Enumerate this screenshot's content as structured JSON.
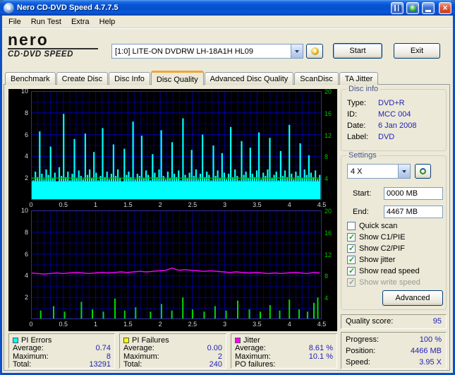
{
  "window": {
    "title": "Nero CD-DVD Speed 4.7.7.5"
  },
  "icons": {
    "close": "×"
  },
  "menu": {
    "items": [
      "File",
      "Run Test",
      "Extra",
      "Help"
    ]
  },
  "header": {
    "logo": {
      "line1": "nero",
      "line2": "CD·DVD SPEED"
    },
    "drive_select": {
      "value": "[1:0]  LITE-ON DVDRW LH-18A1H HL09"
    },
    "start_button": "Start",
    "exit_button": "Exit"
  },
  "tabs": [
    {
      "label": "Benchmark",
      "active": false
    },
    {
      "label": "Create Disc",
      "active": false
    },
    {
      "label": "Disc Info",
      "active": false
    },
    {
      "label": "Disc Quality",
      "active": true
    },
    {
      "label": "Advanced Disc Quality",
      "active": false
    },
    {
      "label": "ScanDisc",
      "active": false
    },
    {
      "label": "TA Jitter",
      "active": false
    }
  ],
  "disc_info": {
    "title": "Disc info",
    "rows": [
      {
        "label": "Type:",
        "value": "DVD+R"
      },
      {
        "label": "ID:",
        "value": "MCC 004"
      },
      {
        "label": "Date:",
        "value": "6 Jan 2008"
      },
      {
        "label": "Label:",
        "value": "DVD"
      }
    ]
  },
  "settings": {
    "title": "Settings",
    "speed_value": "4 X",
    "start_label": "Start:",
    "start_value": "0000 MB",
    "end_label": "End:",
    "end_value": "4467 MB",
    "checkboxes": [
      {
        "label": "Quick scan",
        "checked": false,
        "disabled": false
      },
      {
        "label": "Show C1/PIE",
        "checked": true,
        "disabled": false
      },
      {
        "label": "Show C2/PIF",
        "checked": true,
        "disabled": false
      },
      {
        "label": "Show jitter",
        "checked": true,
        "disabled": false
      },
      {
        "label": "Show read speed",
        "checked": true,
        "disabled": false
      },
      {
        "label": "Show write speed",
        "checked": true,
        "disabled": true
      }
    ],
    "advanced_button": "Advanced"
  },
  "quality": {
    "label": "Quality score:",
    "value": "95"
  },
  "progress": {
    "rows": [
      {
        "label": "Progress:",
        "value": "100 %"
      },
      {
        "label": "Position:",
        "value": "4466 MB"
      },
      {
        "label": "Speed:",
        "value": "3.95 X"
      }
    ]
  },
  "stats_panels": [
    {
      "name": "PI Errors",
      "color": "#00ffff",
      "rows": [
        {
          "label": "Average:",
          "value": "0.74"
        },
        {
          "label": "Maximum:",
          "value": "8"
        },
        {
          "label": "Total:",
          "value": "13291"
        }
      ]
    },
    {
      "name": "PI Failures",
      "color": "#ffff00",
      "rows": [
        {
          "label": "Average:",
          "value": "0.00"
        },
        {
          "label": "Maximum:",
          "value": "2"
        },
        {
          "label": "Total:",
          "value": "240"
        }
      ]
    },
    {
      "name": "Jitter",
      "color": "#ff00ff",
      "rows": [
        {
          "label": "Average:",
          "value": "8.61 %"
        },
        {
          "label": "Maximum:",
          "value": "10.1 %"
        },
        {
          "label": "PO failures:",
          "value": ""
        }
      ]
    }
  ],
  "chart_data": [
    {
      "id": "quality-top",
      "type": "area",
      "title": "PI Errors and read speed vs disc position (GB)",
      "x_range": [
        0,
        4.5
      ],
      "x_end": 4.47,
      "x_ticks": [
        "0",
        "0.5",
        "1",
        "1.5",
        "2",
        "2.5",
        "3",
        "3.5",
        "4",
        "4.5"
      ],
      "left_axis": {
        "max": 10,
        "ticks": [
          2,
          4,
          6,
          8,
          10
        ],
        "color": "#d8d8d8"
      },
      "right_axis": {
        "max": 20,
        "ticks": [
          4,
          8,
          12,
          16,
          20
        ],
        "color": "#00c800"
      },
      "grid": {
        "x_minor": 0.1,
        "x_major": 0.5,
        "y_minor": 1,
        "y_major": 2
      },
      "series": [
        {
          "name": "PI Errors",
          "type": "spikes",
          "axis": "left",
          "color": "#00ffff",
          "base": 1.7,
          "values": [
            2.2,
            1.8,
            2.6,
            2.1,
            6.3,
            2.4,
            1.9,
            2.8,
            2.3,
            4.9,
            2.0,
            2.5,
            1.7,
            3.0,
            2.2,
            7.9,
            2.1,
            2.6,
            1.8,
            2.4,
            5.6,
            2.0,
            2.7,
            2.2,
            1.9,
            6.1,
            2.3,
            2.8,
            2.0,
            4.4,
            2.5,
            1.8,
            2.2,
            6.6,
            2.1,
            2.6,
            1.9,
            2.4,
            5.1,
            2.2,
            2.8,
            2.0,
            1.7,
            4.7,
            2.3,
            2.6,
            2.1,
            7.2,
            1.9,
            2.4,
            2.2,
            5.9,
            2.0,
            2.7,
            2.3,
            1.8,
            4.2,
            2.5,
            2.1,
            2.8,
            6.4,
            2.2,
            1.9,
            2.6,
            2.0,
            5.3,
            2.4,
            2.1,
            2.7,
            1.8,
            7.5,
            2.3,
            2.0,
            2.5,
            4.6,
            2.2,
            2.8,
            1.9,
            2.4,
            6.0,
            2.1,
            2.6,
            2.3,
            1.8,
            5.0,
            2.2,
            2.7,
            2.0,
            4.3,
            2.5,
            1.9,
            2.4,
            6.7,
            2.1,
            2.8,
            2.2,
            1.8,
            5.4,
            2.3,
            2.6,
            2.0,
            4.8,
            2.4,
            2.1,
            2.7,
            6.2,
            1.9,
            2.5,
            2.2,
            2.8,
            5.7,
            2.0,
            2.3,
            2.6,
            1.8,
            4.5,
            2.2,
            2.7,
            2.1,
            6.9,
            2.4,
            1.9,
            2.6,
            2.2,
            5.2,
            2.0,
            2.8,
            2.3,
            4.1,
            2.5,
            2.1,
            2.7,
            1.9,
            2.3
          ]
        },
        {
          "name": "Read speed",
          "type": "hline",
          "axis": "right",
          "color": "#00b400",
          "value": 4
        }
      ]
    },
    {
      "id": "quality-bottom",
      "type": "line",
      "title": "PI Failures and jitter vs disc position (GB)",
      "x_range": [
        0,
        4.5
      ],
      "x_end": 4.47,
      "x_ticks": [
        "0",
        "0.5",
        "1",
        "1.5",
        "2",
        "2.5",
        "3",
        "3.5",
        "4",
        "4.5"
      ],
      "left_axis": {
        "max": 10,
        "ticks": [
          2,
          4,
          6,
          8,
          10
        ],
        "color": "#d8d8d8"
      },
      "right_axis": {
        "max": 20,
        "ticks": [
          4,
          8,
          12,
          16,
          20
        ],
        "color": "#00c800"
      },
      "grid": {
        "x_minor": 0.1,
        "x_major": 0.5,
        "y_minor": 1,
        "y_major": 2
      },
      "series": [
        {
          "name": "PI Failures",
          "type": "bars",
          "axis": "left",
          "color": "#00dc00",
          "points": [
            [
              0.15,
              0.8
            ],
            [
              0.35,
              1.2
            ],
            [
              0.52,
              0.7
            ],
            [
              0.78,
              1.6
            ],
            [
              0.95,
              0.9
            ],
            [
              1.12,
              0.7
            ],
            [
              1.3,
              1.9
            ],
            [
              1.45,
              0.8
            ],
            [
              1.62,
              1.1
            ],
            [
              1.85,
              0.7
            ],
            [
              2.02,
              1.4
            ],
            [
              2.18,
              0.8
            ],
            [
              2.35,
              2.0
            ],
            [
              2.5,
              0.9
            ],
            [
              2.68,
              0.7
            ],
            [
              2.85,
              1.2
            ],
            [
              3.02,
              0.8
            ],
            [
              3.2,
              1.7
            ],
            [
              3.38,
              0.9
            ],
            [
              3.55,
              0.7
            ],
            [
              3.7,
              1.3
            ],
            [
              3.85,
              0.8
            ],
            [
              4.0,
              1.8
            ],
            [
              4.15,
              0.9
            ],
            [
              4.28,
              0.7
            ],
            [
              4.38,
              1.5
            ],
            [
              4.44,
              2.0
            ]
          ]
        },
        {
          "name": "Jitter",
          "type": "line",
          "axis": "right",
          "color": "#ff00ff",
          "values": [
            8.5,
            8.4,
            8.3,
            8.4,
            8.5,
            8.4,
            8.5,
            8.6,
            8.5,
            8.4,
            8.5,
            8.6,
            8.5,
            8.6,
            8.7,
            8.6,
            8.7,
            8.8,
            8.7,
            8.8,
            8.9,
            9.0,
            9.4,
            9.0,
            9.1,
            9.0,
            8.9,
            8.8,
            8.9,
            8.8,
            8.7,
            8.6,
            8.7,
            8.6,
            8.5,
            8.6,
            8.5,
            8.4,
            8.5,
            8.4,
            8.5,
            8.6,
            8.5,
            8.4,
            8.6,
            8.5
          ]
        }
      ]
    }
  ]
}
